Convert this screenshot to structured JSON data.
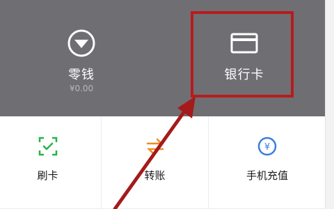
{
  "wallet": {
    "change": {
      "label": "零钱",
      "amount": "¥0.00",
      "icon": "change-icon"
    },
    "bank_card": {
      "label": "银行卡",
      "icon": "bank-card-icon"
    }
  },
  "services": [
    {
      "label": "刷卡",
      "icon": "scan-card-icon",
      "color": "#27b24a"
    },
    {
      "label": "转账",
      "icon": "transfer-icon",
      "color": "#f08a24"
    },
    {
      "label": "手机充值",
      "icon": "mobile-recharge-icon",
      "color": "#3b7ddd"
    }
  ],
  "colors": {
    "panel_bg": "#6f6f73",
    "highlight": "#b71c1c",
    "arrow": "#a51a1a"
  }
}
